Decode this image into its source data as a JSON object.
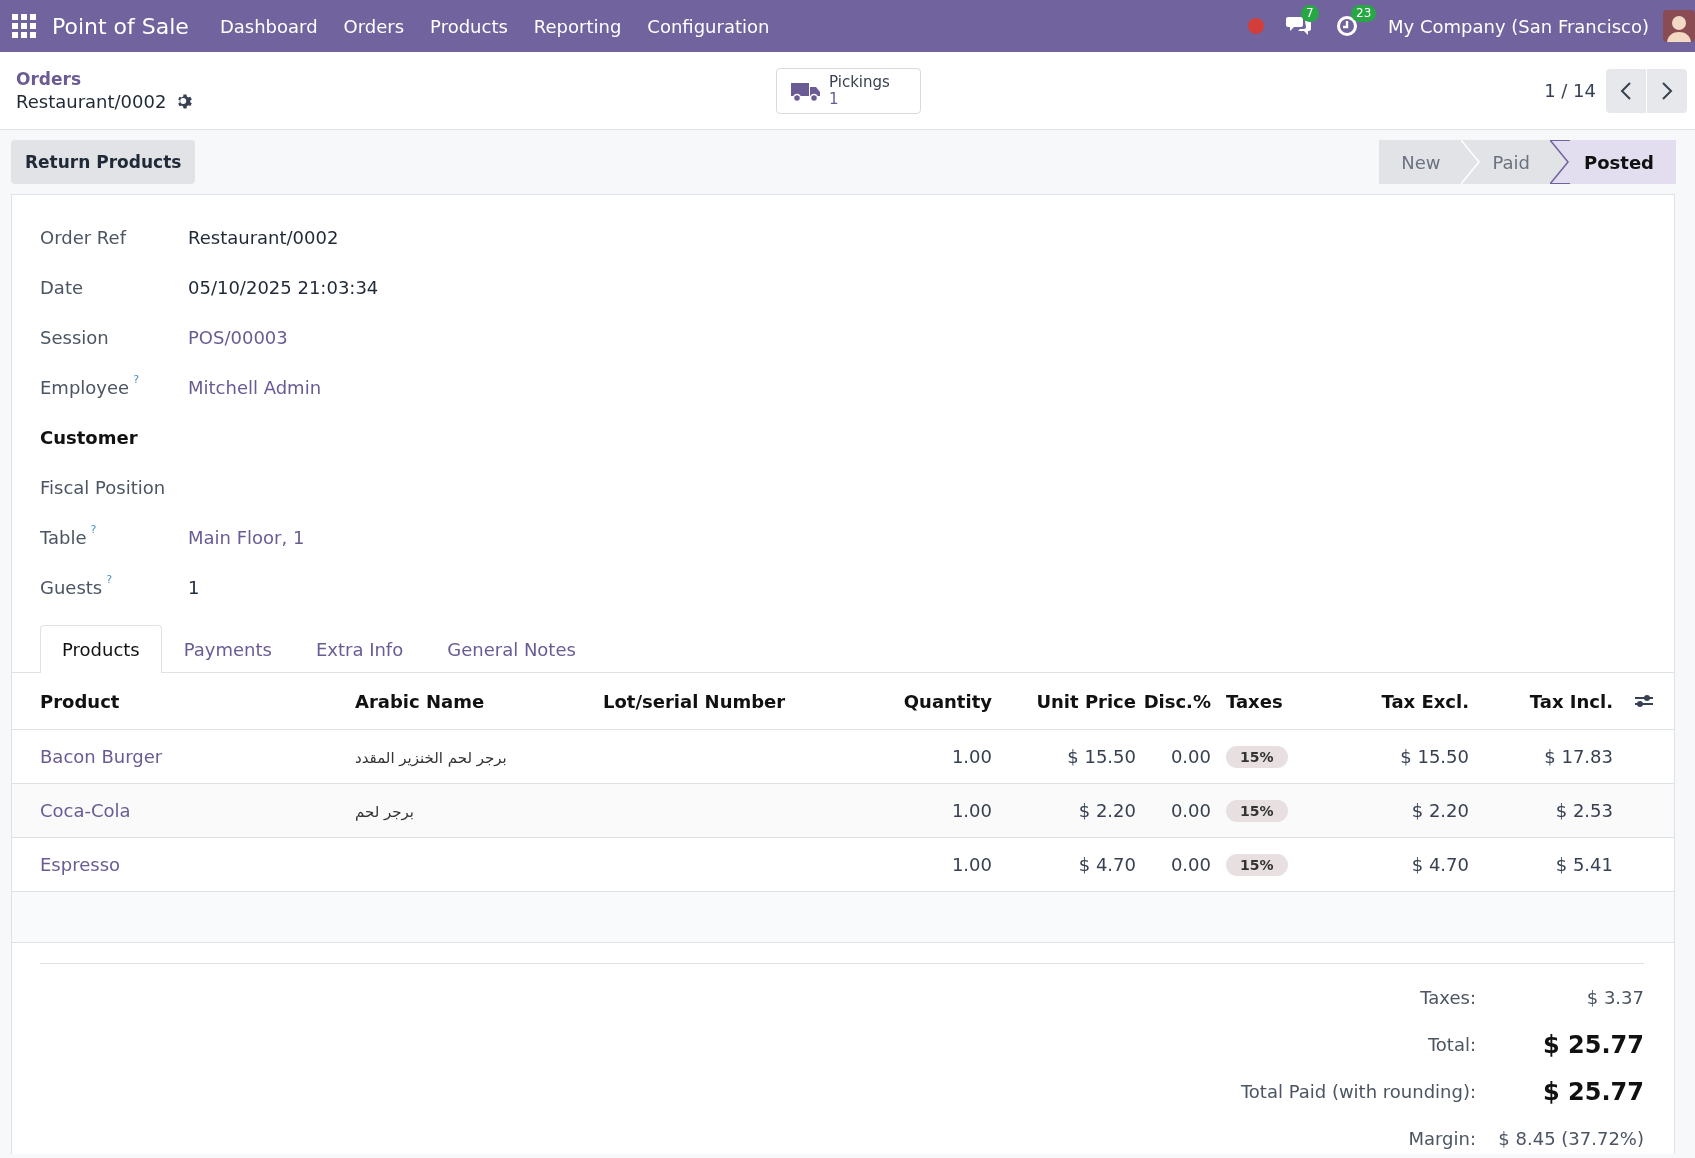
{
  "navbar": {
    "app_title": "Point of Sale",
    "menu": [
      "Dashboard",
      "Orders",
      "Products",
      "Reporting",
      "Configuration"
    ],
    "messages_count": "7",
    "activities_count": "23",
    "company": "My Company (San Francisco)"
  },
  "control_panel": {
    "breadcrumb": "Orders",
    "record": "Restaurant/0002",
    "smart_button": {
      "label": "Pickings",
      "value": "1"
    },
    "pager": "1 / 14"
  },
  "action_buttons": [
    "Return Products"
  ],
  "statusbar": [
    {
      "label": "New",
      "selected": false
    },
    {
      "label": "Paid",
      "selected": false
    },
    {
      "label": "Posted",
      "selected": true
    }
  ],
  "fields": [
    {
      "label": "Order Ref",
      "value": "Restaurant/0002",
      "kind": "text"
    },
    {
      "label": "Date",
      "value": "05/10/2025 21:03:34",
      "kind": "text"
    },
    {
      "label": "Session",
      "value": "POS/00003",
      "kind": "link"
    },
    {
      "label": "Employee",
      "help": "?",
      "value": "Mitchell Admin",
      "kind": "link"
    },
    {
      "label": "Customer",
      "kind": "heading"
    },
    {
      "label": "Fiscal Position",
      "kind": "text"
    },
    {
      "label": "Table",
      "help": "?",
      "value": "Main Floor, 1",
      "kind": "link"
    },
    {
      "label": "Guests",
      "help": "?",
      "value": "1",
      "kind": "text"
    }
  ],
  "tabs": [
    {
      "label": "Products",
      "selected": true
    },
    {
      "label": "Payments",
      "selected": false
    },
    {
      "label": "Extra Info",
      "selected": false
    },
    {
      "label": "General Notes",
      "selected": false
    }
  ],
  "table": {
    "columns": [
      {
        "label": "Product",
        "kind": "link"
      },
      {
        "label": "Arabic Name",
        "kind": "text"
      },
      {
        "label": "Lot/serial Number",
        "kind": "text"
      },
      {
        "label": "Quantity",
        "kind": "number"
      },
      {
        "label": "Unit Price",
        "kind": "number"
      },
      {
        "label": "Disc.%",
        "kind": "number"
      },
      {
        "label": "Taxes",
        "kind": "tag"
      },
      {
        "label": "Tax Excl.",
        "kind": "number"
      },
      {
        "label": "Tax Incl.",
        "kind": "number"
      }
    ],
    "rows": [
      {
        "cells": [
          "Bacon Burger",
          "برجر لحم الخنزير المقدد",
          "",
          "1.00",
          "$ 15.50",
          "0.00",
          "15%",
          "$ 15.50",
          "$ 17.83"
        ]
      },
      {
        "cells": [
          "Coca-Cola",
          "برجر لحم",
          "",
          "1.00",
          "$ 2.20",
          "0.00",
          "15%",
          "$ 2.20",
          "$ 2.53"
        ]
      },
      {
        "cells": [
          "Espresso",
          "",
          "",
          "1.00",
          "$ 4.70",
          "0.00",
          "15%",
          "$ 4.70",
          "$ 5.41"
        ]
      }
    ]
  },
  "totals": [
    {
      "label": "Taxes:",
      "value": "$ 3.37",
      "kind": "normal"
    },
    {
      "label": "Total:",
      "value": "$ 25.77",
      "kind": "grand"
    },
    {
      "label": "Total Paid (with rounding):",
      "value": "$ 25.77",
      "kind": "grand"
    },
    {
      "label": "Margin:",
      "value": "$ 8.45 (37.72%)",
      "kind": "normal"
    }
  ]
}
